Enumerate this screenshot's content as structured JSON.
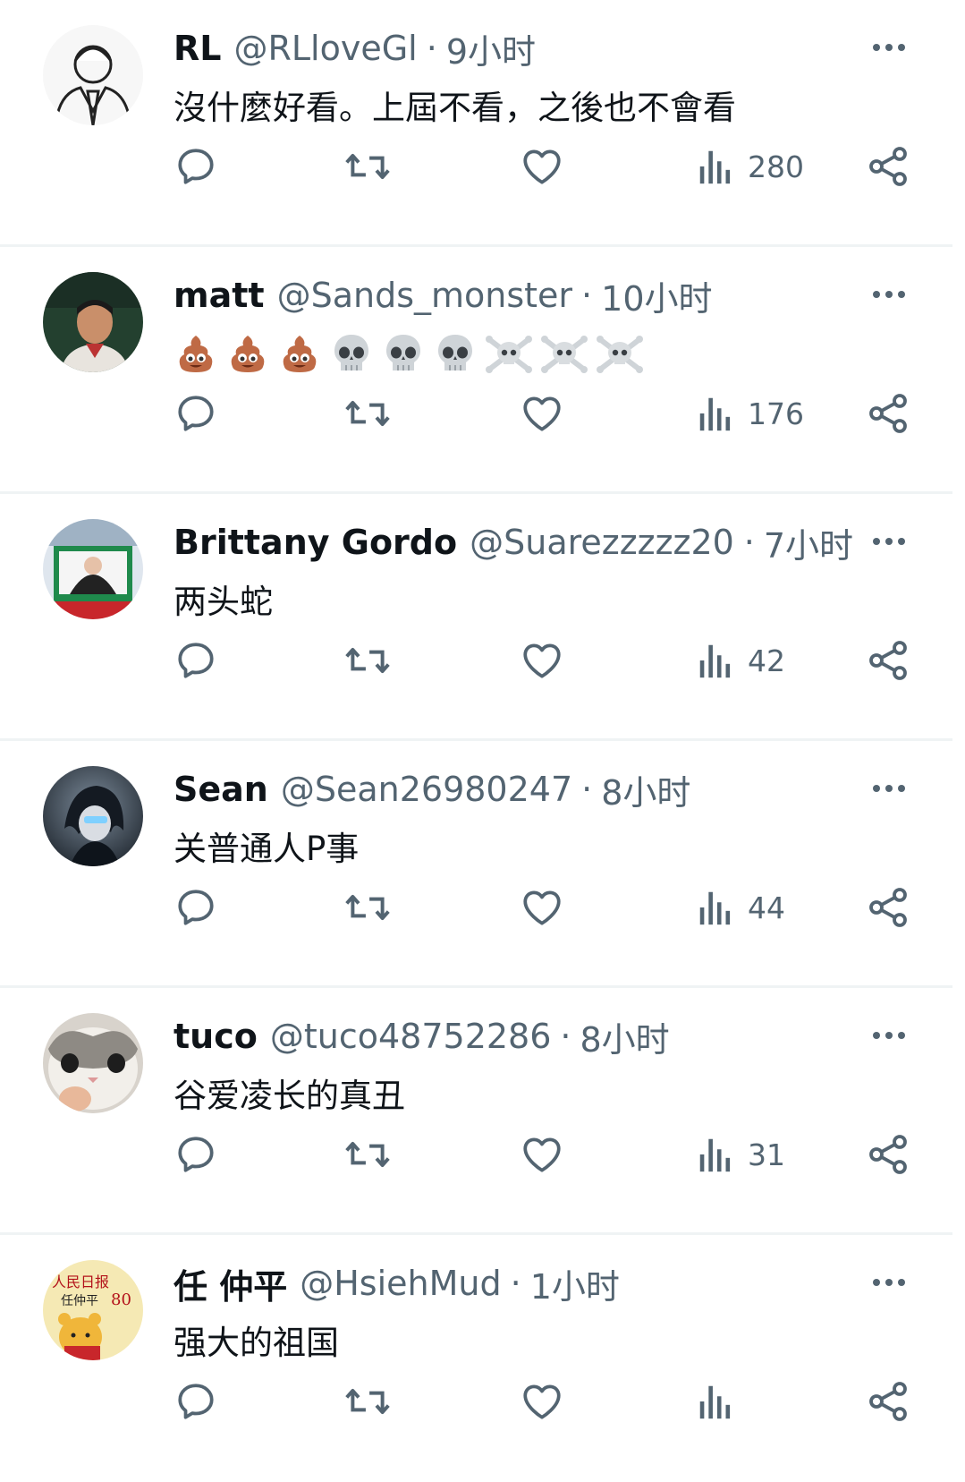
{
  "replies": [
    {
      "name": "RL",
      "handle": "@RLloveGl",
      "time": "9小时",
      "text": "沒什麼好看。上屆不看，之後也不會看",
      "views": "280",
      "avatar": {
        "bg": "#ffffff",
        "kind": "person-outline-icon"
      }
    },
    {
      "name": "matt",
      "handle": "@Sands_monster",
      "time": "10小时",
      "text": "",
      "emojis": [
        "poop",
        "poop",
        "poop",
        "skull",
        "skull",
        "skull",
        "skull-crossbones",
        "skull-crossbones",
        "skull-crossbones"
      ],
      "views": "176",
      "avatar": {
        "bg": "#2c4a3a",
        "kind": "man-photo-icon"
      }
    },
    {
      "name": "Brittany Gordo",
      "handle": "@Suarezzzzz20:",
      "time": "7小时",
      "text": "两头蛇",
      "views": "42",
      "avatar": {
        "bg": "#1f8a4c",
        "kind": "poster-photo-icon"
      }
    },
    {
      "name": "Sean",
      "handle": "@Sean26980247",
      "time": "8小时",
      "text": "关普通人P事",
      "views": "44",
      "avatar": {
        "bg": "#2a3340",
        "kind": "anime-character-icon"
      }
    },
    {
      "name": "tuco",
      "handle": "@tuco48752286",
      "time": "8小时",
      "text": "谷爱凌长的真丑",
      "views": "31",
      "avatar": {
        "bg": "#c9c4bd",
        "kind": "cat-photo-icon"
      }
    },
    {
      "name": "任 仲平",
      "handle": "@HsiehMud",
      "time": "1小时",
      "text": "强大的祖国",
      "views": "",
      "avatar": {
        "bg": "#f4e6a8",
        "kind": "pooh-book-icon",
        "lettering": "人民日报 任仲平 80篇"
      }
    }
  ],
  "colors": {
    "text": "#0f1419",
    "secondary": "#536471",
    "divider": "#eff3f4"
  }
}
